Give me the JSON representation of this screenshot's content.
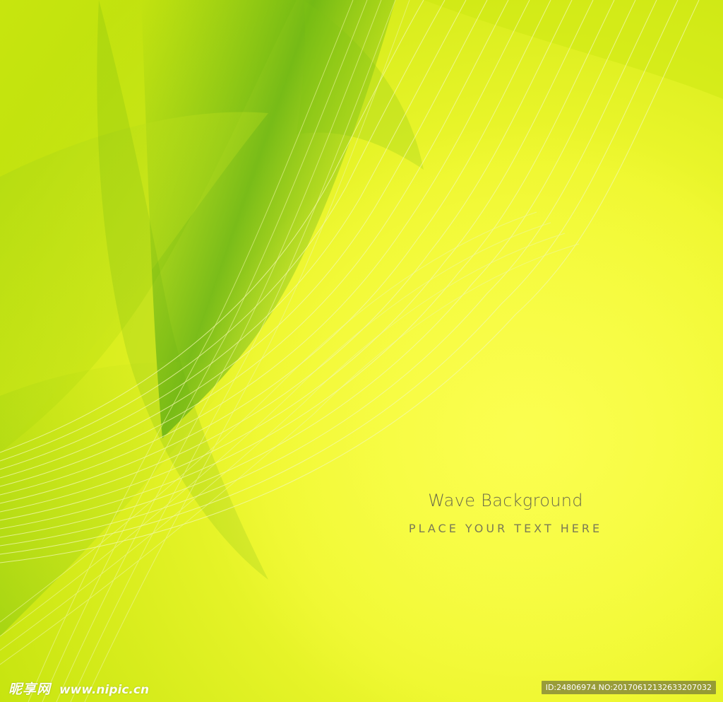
{
  "poster": {
    "title": "Wave Background",
    "subtitle": "PLACE YOUR TEXT HERE"
  },
  "watermark": {
    "brand_glyphs": "昵享网",
    "site": "www.nipic.cn",
    "id_text": "ID:24806974 NO:20170612132633207032"
  },
  "colors": {
    "base_yellow": "#f4fb38",
    "deep_green": "#3e9e12",
    "mid_green": "#7fc415",
    "light_lime": "#cfe90e",
    "line_color": "#f0f7a8"
  }
}
